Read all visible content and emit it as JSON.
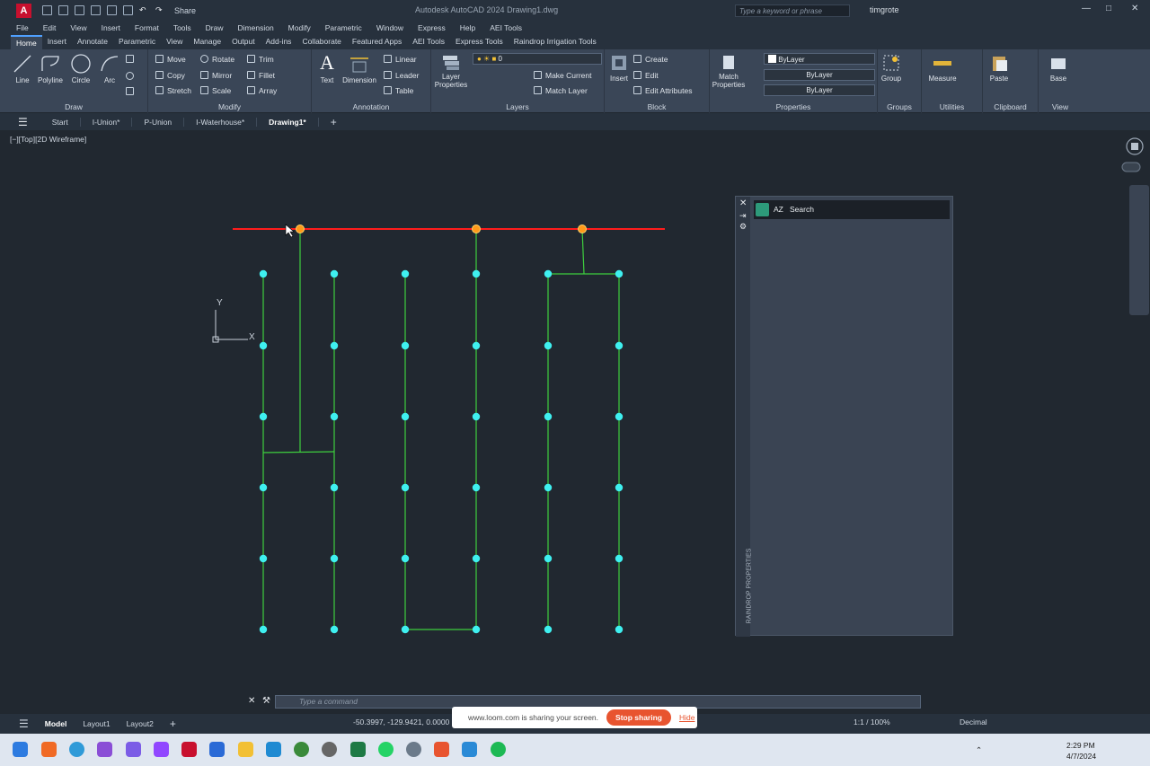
{
  "window": {
    "app_logo": "A",
    "title": "Autodesk AutoCAD 2024    Drawing1.dwg",
    "share_label": "Share",
    "search_placeholder": "Type a keyword or phrase",
    "user": "timgrote"
  },
  "menubar": [
    "File",
    "Edit",
    "View",
    "Insert",
    "Format",
    "Tools",
    "Draw",
    "Dimension",
    "Modify",
    "Parametric",
    "Window",
    "Express",
    "Help",
    "AEI Tools"
  ],
  "ribbon_tabs": [
    "Home",
    "Insert",
    "Annotate",
    "Parametric",
    "View",
    "Manage",
    "Output",
    "Add-ins",
    "Collaborate",
    "Featured Apps",
    "AEI Tools",
    "Express Tools",
    "Raindrop Irrigation Tools"
  ],
  "ribbon": {
    "draw": {
      "label": "Draw",
      "line": "Line",
      "polyline": "Polyline",
      "circle": "Circle",
      "arc": "Arc"
    },
    "modify": {
      "label": "Modify",
      "move": "Move",
      "rotate": "Rotate",
      "trim": "Trim",
      "copy": "Copy",
      "mirror": "Mirror",
      "fillet": "Fillet",
      "stretch": "Stretch",
      "scale": "Scale",
      "array": "Array"
    },
    "annotation": {
      "label": "Annotation",
      "text": "Text",
      "dimension": "Dimension",
      "linear": "Linear",
      "leader": "Leader",
      "table": "Table"
    },
    "layers": {
      "label": "Layers",
      "layer_properties_1": "Layer",
      "layer_properties_2": "Properties",
      "layer_value": "0",
      "make_current": "Make Current",
      "match_layer": "Match Layer"
    },
    "block": {
      "label": "Block",
      "insert": "Insert",
      "create": "Create",
      "edit": "Edit",
      "edit_attributes": "Edit Attributes"
    },
    "properties": {
      "label": "Properties",
      "match_1": "Match",
      "match_2": "Properties",
      "color": "ByLayer",
      "linetype": "ByLayer",
      "lineweight": "ByLayer"
    },
    "groups": {
      "label": "Groups",
      "group": "Group"
    },
    "utilities": {
      "label": "Utilities",
      "measure": "Measure"
    },
    "clipboard": {
      "label": "Clipboard",
      "paste": "Paste"
    },
    "view": {
      "label": "View",
      "base": "Base"
    }
  },
  "doc_tabs": [
    "Start",
    "I-Union*",
    "P-Union",
    "I-Waterhouse*",
    "Drawing1*"
  ],
  "viewport_label": "[−][Top][2D Wireframe]",
  "ucs": {
    "y": "Y",
    "x": "X"
  },
  "palette": {
    "search": "Search",
    "sort_label": "AZ",
    "title": "RAINDROP PROPERTIES"
  },
  "command_placeholder": "Type a command",
  "layout_tabs": [
    "Model",
    "Layout1",
    "Layout2"
  ],
  "coordinates": "-50.3997, -129.9421, 0.0000",
  "loom": {
    "message": "www.loom.com is sharing your screen.",
    "stop": "Stop sharing",
    "hide": "Hide"
  },
  "status_right": {
    "scale": "1:1 / 100%",
    "units": "Decimal"
  },
  "taskbar": {
    "time": "2:29 PM",
    "date": "4/7/2024"
  },
  "colors": {
    "mainline": "#ff1c1c",
    "lateral": "#3ecf3e",
    "head": "#3ff0f0",
    "valve": "#ff9a1a"
  }
}
